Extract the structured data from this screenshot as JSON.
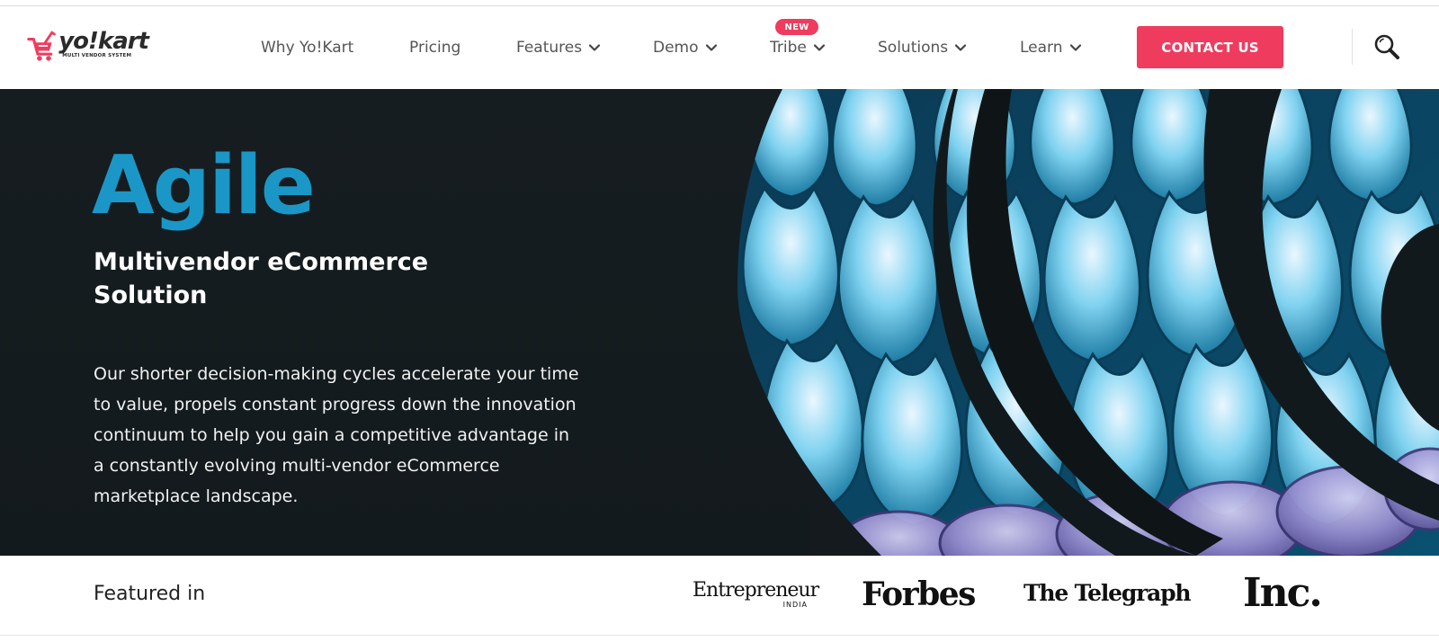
{
  "header": {
    "logo": {
      "word": "yo!kart",
      "tagline": "MULTI VENDOR SYSTEM"
    },
    "nav": [
      {
        "label": "Why Yo!Kart",
        "has_dropdown": false
      },
      {
        "label": "Pricing",
        "has_dropdown": false
      },
      {
        "label": "Features",
        "has_dropdown": true
      },
      {
        "label": "Demo",
        "has_dropdown": true
      },
      {
        "label": "Tribe",
        "has_dropdown": true,
        "badge": "NEW"
      },
      {
        "label": "Solutions",
        "has_dropdown": true
      },
      {
        "label": "Learn",
        "has_dropdown": true
      }
    ],
    "contact_label": "CONTACT US",
    "search_icon": "search-icon"
  },
  "hero": {
    "title": "Agile",
    "subtitle": "Multivendor eCommerce Solution",
    "body": "Our shorter decision-making cycles accelerate your time to value, propels constant progress down the innovation continuum to help you gain a competitive advantage in a constantly evolving multi-vendor eCommerce marketplace landscape."
  },
  "featured": {
    "label": "Featured in",
    "logos": {
      "entrepreneur": "Entrepreneur",
      "entrepreneur_sub": "INDIA",
      "forbes": "Forbes",
      "telegraph": "The Telegraph",
      "inc": "Inc."
    }
  },
  "colors": {
    "accent": "#ef3c5e",
    "hero_title": "#1a97c7",
    "hero_bg": "#141a1d"
  }
}
